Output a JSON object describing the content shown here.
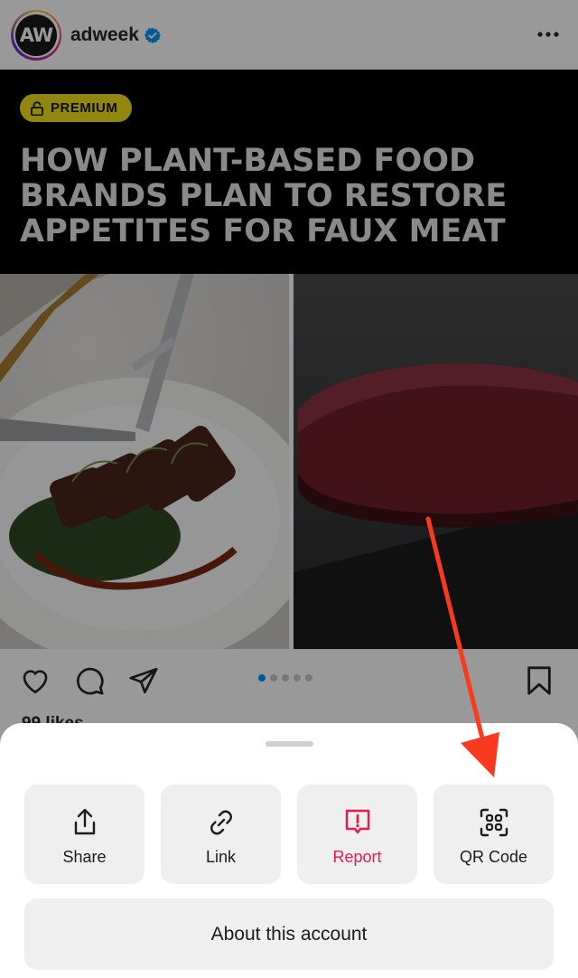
{
  "post": {
    "avatar_text": "AW",
    "username": "adweek",
    "verified": true,
    "badge_label": "PREMIUM",
    "headline": "HOW PLANT-BASED FOOD BRANDS PLAN TO RESTORE APPETITES FOR FAUX MEAT",
    "likes_text": "99 likes",
    "carousel": {
      "count": 5,
      "active_index": 0
    }
  },
  "sheet": {
    "tiles": [
      {
        "label": "Share",
        "icon": "share-icon"
      },
      {
        "label": "Link",
        "icon": "link-icon"
      },
      {
        "label": "Report",
        "icon": "report-icon"
      },
      {
        "label": "QR Code",
        "icon": "qr-code-icon"
      }
    ],
    "about_label": "About this account"
  },
  "colors": {
    "accent_blue": "#0095f6",
    "report_red": "#ed174b",
    "badge_yellow": "#f2e21a",
    "annotation_red": "#fa3a1e"
  }
}
